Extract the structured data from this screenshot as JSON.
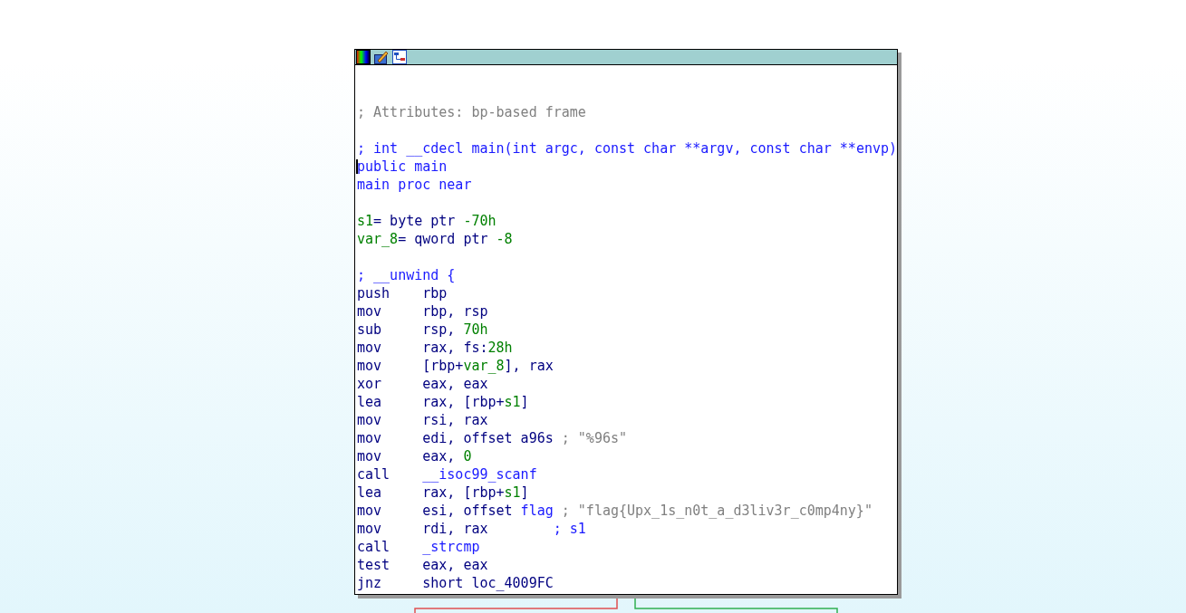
{
  "node": {
    "lines": [
      {
        "segments": [
          {
            "kind": "comment",
            "text": "; Attributes: bp-based frame"
          }
        ]
      },
      {
        "spaced": true,
        "segments": [
          {
            "kind": "directive",
            "text": "; int __cdecl main(int argc, const char **argv, const char **envp)"
          }
        ]
      },
      {
        "cursor": true,
        "segments": [
          {
            "kind": "directive",
            "text": "public main"
          }
        ]
      },
      {
        "segments": [
          {
            "kind": "directive",
            "text": "main proc near"
          }
        ]
      },
      {
        "spaced": true,
        "segments": [
          {
            "kind": "local",
            "text": "s1"
          },
          {
            "kind": "plain",
            "text": "= byte ptr "
          },
          {
            "kind": "number",
            "text": "-70h"
          }
        ]
      },
      {
        "segments": [
          {
            "kind": "local",
            "text": "var_8"
          },
          {
            "kind": "plain",
            "text": "= qword ptr "
          },
          {
            "kind": "number",
            "text": "-8"
          }
        ]
      },
      {
        "spaced": true,
        "segments": [
          {
            "kind": "directive",
            "text": "; __unwind {"
          }
        ]
      },
      {
        "mnemonic": "push",
        "segments": [
          {
            "kind": "plain",
            "text": "rbp"
          }
        ]
      },
      {
        "mnemonic": "mov",
        "segments": [
          {
            "kind": "plain",
            "text": "rbp, rsp"
          }
        ]
      },
      {
        "mnemonic": "sub",
        "segments": [
          {
            "kind": "plain",
            "text": "rsp, "
          },
          {
            "kind": "number",
            "text": "70h"
          }
        ]
      },
      {
        "mnemonic": "mov",
        "segments": [
          {
            "kind": "plain",
            "text": "rax, fs:"
          },
          {
            "kind": "number",
            "text": "28h"
          }
        ]
      },
      {
        "mnemonic": "mov",
        "segments": [
          {
            "kind": "plain",
            "text": "[rbp+"
          },
          {
            "kind": "local",
            "text": "var_8"
          },
          {
            "kind": "plain",
            "text": "], rax"
          }
        ]
      },
      {
        "mnemonic": "xor",
        "segments": [
          {
            "kind": "plain",
            "text": "eax, eax"
          }
        ]
      },
      {
        "mnemonic": "lea",
        "segments": [
          {
            "kind": "plain",
            "text": "rax, [rbp+"
          },
          {
            "kind": "local",
            "text": "s1"
          },
          {
            "kind": "plain",
            "text": "]"
          }
        ]
      },
      {
        "mnemonic": "mov",
        "segments": [
          {
            "kind": "plain",
            "text": "rsi, rax"
          }
        ]
      },
      {
        "mnemonic": "mov",
        "segments": [
          {
            "kind": "plain",
            "text": "edi, offset a96s"
          },
          {
            "kind": "comment",
            "text": " ; \"%96s\""
          }
        ]
      },
      {
        "mnemonic": "mov",
        "segments": [
          {
            "kind": "plain",
            "text": "eax, "
          },
          {
            "kind": "number",
            "text": "0"
          }
        ]
      },
      {
        "mnemonic": "call",
        "segments": [
          {
            "kind": "name",
            "text": "__isoc99_scanf"
          }
        ]
      },
      {
        "mnemonic": "lea",
        "segments": [
          {
            "kind": "plain",
            "text": "rax, [rbp+"
          },
          {
            "kind": "local",
            "text": "s1"
          },
          {
            "kind": "plain",
            "text": "]"
          }
        ]
      },
      {
        "mnemonic": "mov",
        "segments": [
          {
            "kind": "plain",
            "text": "esi, offset "
          },
          {
            "kind": "name",
            "text": "flag"
          },
          {
            "kind": "comment",
            "text": " ; \"flag{Upx_1s_n0t_a_d3liv3r_c0mp4ny}\""
          }
        ]
      },
      {
        "mnemonic": "mov",
        "segments": [
          {
            "kind": "plain",
            "text": "rdi, rax"
          },
          {
            "kind": "tabcomment",
            "text": "; s1"
          }
        ]
      },
      {
        "mnemonic": "call",
        "segments": [
          {
            "kind": "name",
            "text": "_strcmp"
          }
        ]
      },
      {
        "mnemonic": "test",
        "segments": [
          {
            "kind": "plain",
            "text": "eax, eax"
          }
        ]
      },
      {
        "mnemonic": "jnz",
        "segments": [
          {
            "kind": "plain",
            "text": "short loc_4009FC"
          }
        ]
      }
    ]
  }
}
